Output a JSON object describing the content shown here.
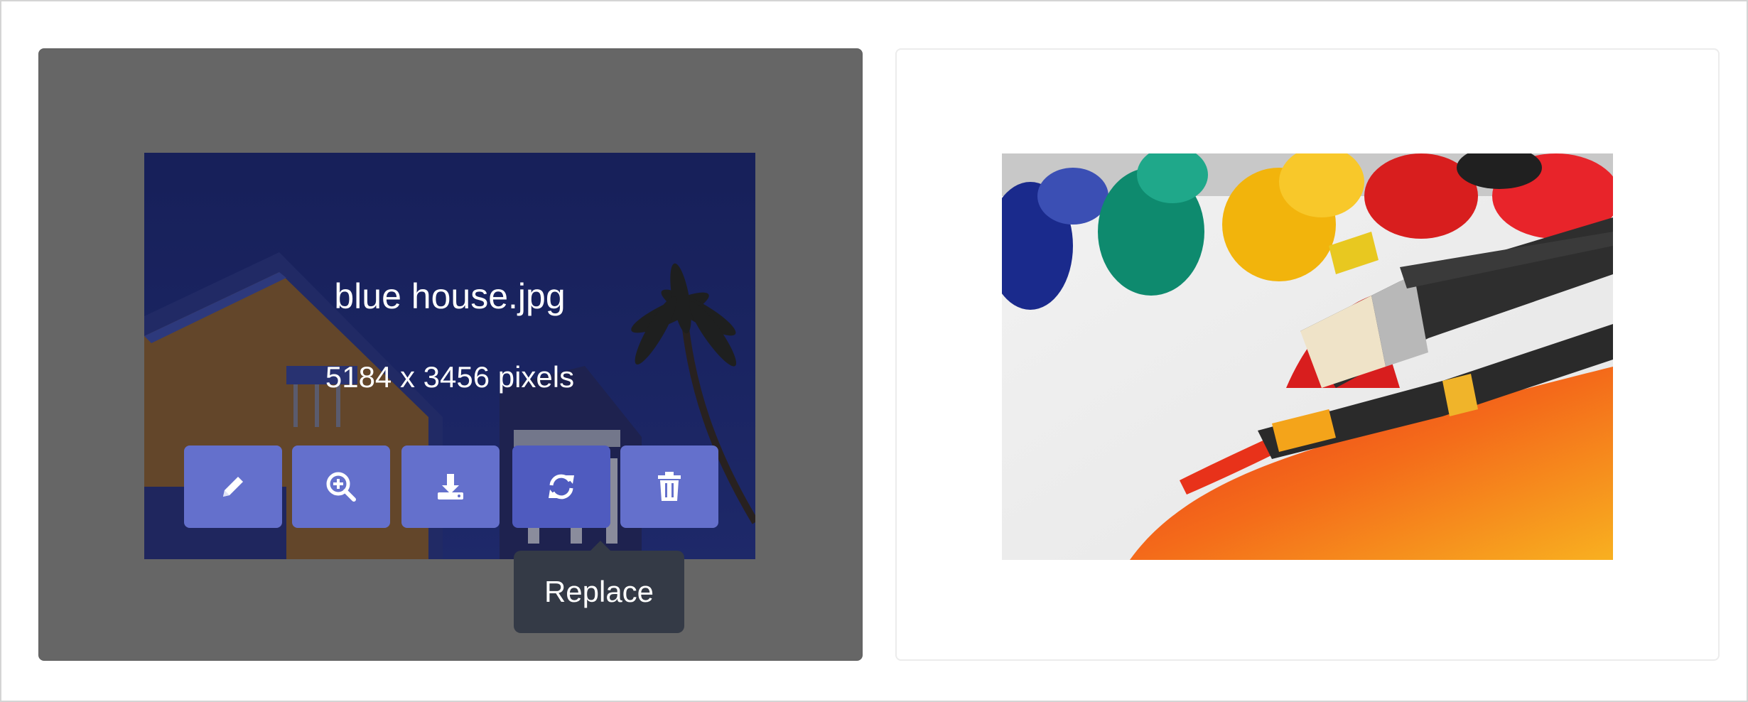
{
  "left_card": {
    "file_name": "blue house.jpg",
    "file_size": "5184 x 3456 pixels",
    "actions": [
      {
        "name": "edit-button",
        "icon": "pencil-icon"
      },
      {
        "name": "zoom-button",
        "icon": "zoom-in-icon"
      },
      {
        "name": "download-button",
        "icon": "download-icon"
      },
      {
        "name": "replace-button",
        "icon": "refresh-icon"
      },
      {
        "name": "delete-button",
        "icon": "trash-icon"
      }
    ],
    "tooltip": "Replace"
  },
  "right_card": {
    "image": "paint-brushes-photo"
  },
  "colors": {
    "button": "#6470cc",
    "button_active": "#4f5bbf",
    "overlay": "#666666",
    "tooltip": "#343a46"
  }
}
